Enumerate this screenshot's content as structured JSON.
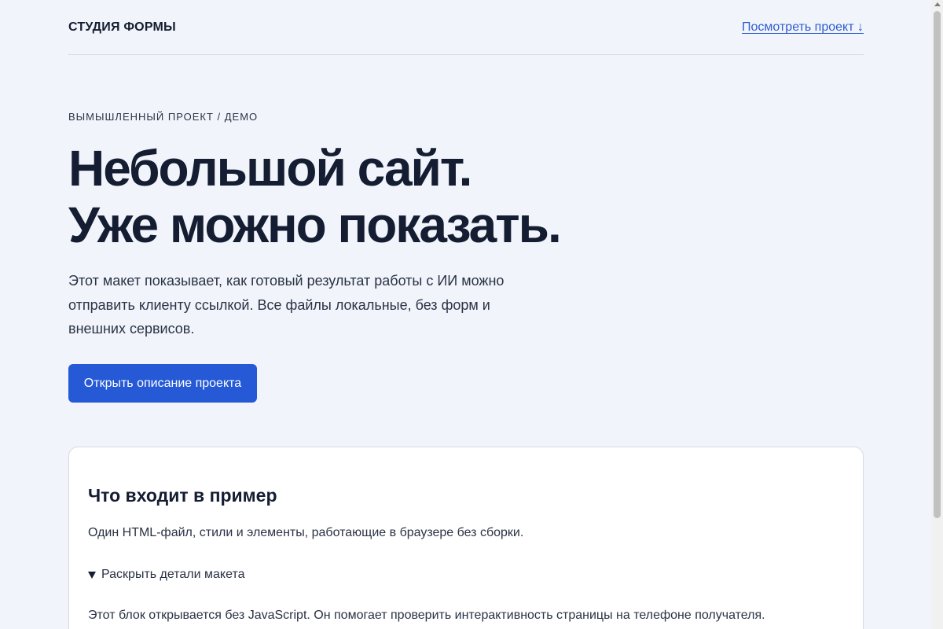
{
  "header": {
    "brand": "СТУДИЯ ФОРМЫ",
    "view_link": "Посмотреть проект ↓"
  },
  "hero": {
    "eyebrow": "ВЫМЫШЛЕННЫЙ ПРОЕКТ / ДЕМО",
    "title_line1": "Небольшой сайт.",
    "title_line2": "Уже можно показать.",
    "lead": "Этот макет показывает, как готовый результат работы с ИИ можно отправить клиенту ссылкой. Все файлы локальные, без форм и внешних сервисов.",
    "cta_label": "Открыть описание проекта"
  },
  "card": {
    "title": "Что входит в пример",
    "text": "Один HTML-файл, стили и элементы, работающие в браузере без сборки.",
    "details_summary": "Раскрыть детали макета",
    "details_text": "Этот блок открывается без JavaScript. Он помогает проверить интерактивность страницы на телефоне получателя."
  },
  "colors": {
    "background": "#f1f5fb",
    "accent": "#2559d6",
    "text": "#141d31"
  },
  "icons": {
    "details_marker": "triangle-down-icon"
  }
}
